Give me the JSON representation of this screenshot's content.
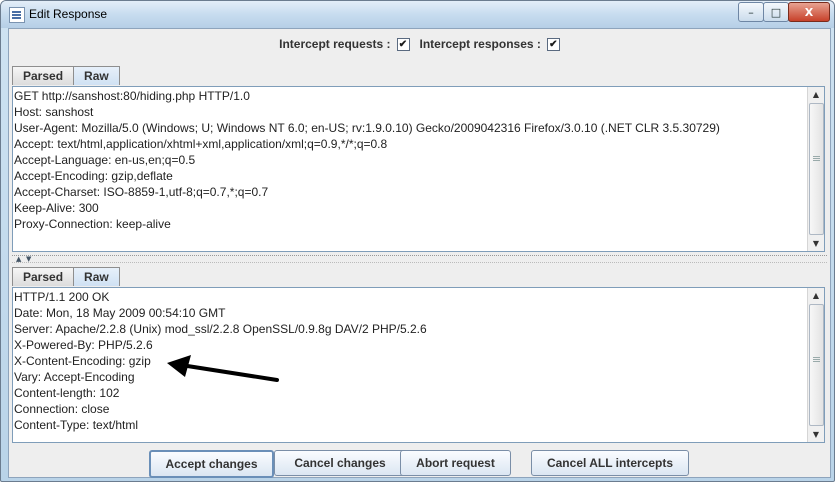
{
  "window": {
    "title": "Edit Response",
    "controls": {
      "minimize": "–",
      "maximize": "□",
      "close": "X"
    }
  },
  "intercepts": {
    "requests_label": "Intercept requests :",
    "requests_checked": "✔",
    "responses_label": "Intercept responses :",
    "responses_checked": "✔"
  },
  "request_pane": {
    "tabs": [
      {
        "label": "Parsed",
        "active": false
      },
      {
        "label": "Raw",
        "active": true
      }
    ],
    "lines": [
      "GET http://sanshost:80/hiding.php HTTP/1.0",
      "Host: sanshost",
      "User-Agent: Mozilla/5.0 (Windows; U; Windows NT 6.0; en-US; rv:1.9.0.10) Gecko/2009042316 Firefox/3.0.10 (.NET CLR 3.5.30729)",
      "Accept: text/html,application/xhtml+xml,application/xml;q=0.9,*/*;q=0.8",
      "Accept-Language: en-us,en;q=0.5",
      "Accept-Encoding: gzip,deflate",
      "Accept-Charset: ISO-8859-1,utf-8;q=0.7,*;q=0.7",
      "Keep-Alive: 300",
      "Proxy-Connection: keep-alive"
    ]
  },
  "response_pane": {
    "tabs": [
      {
        "label": "Parsed",
        "active": false
      },
      {
        "label": "Raw",
        "active": true
      }
    ],
    "lines": [
      "HTTP/1.1 200 OK",
      "Date: Mon, 18 May 2009 00:54:10 GMT",
      "Server: Apache/2.2.8 (Unix) mod_ssl/2.2.8 OpenSSL/0.9.8g DAV/2 PHP/5.2.6",
      "X-Powered-By: PHP/5.2.6",
      "X-Content-Encoding: gzip",
      "Vary: Accept-Encoding",
      "Content-length: 102",
      "Connection: close",
      "Content-Type: text/html"
    ]
  },
  "buttons": {
    "accept": "Accept changes",
    "cancel": "Cancel changes",
    "abort": "Abort request",
    "cancel_all": "Cancel ALL intercepts"
  },
  "icons": {
    "app": "window-icon",
    "annotation": "arrow-icon"
  },
  "colors": {
    "titlebar": "#c7dcef",
    "client": "#eeeeee",
    "annotation_arrow": "#000000"
  }
}
